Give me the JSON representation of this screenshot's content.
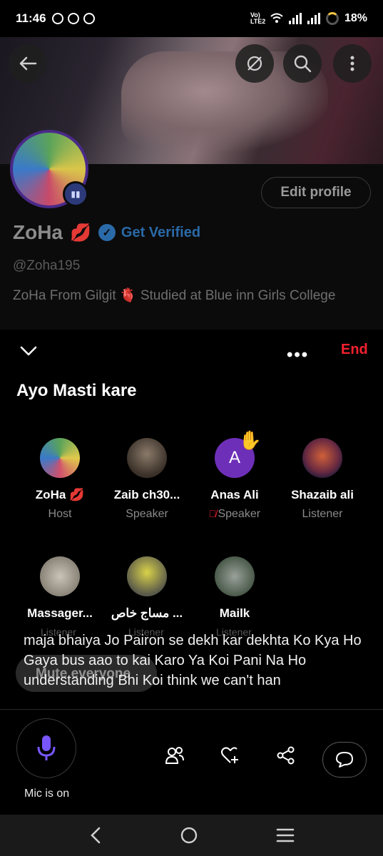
{
  "status_bar": {
    "time": "11:46",
    "network_label": "Vo) LTE2",
    "battery": "18%"
  },
  "profile": {
    "name": "ZoHa",
    "name_emoji": "💋",
    "verified_label": "Get Verified",
    "handle": "@Zoha195",
    "bio": "ZoHa From Gilgit 🫀  Studied at Blue inn Girls College",
    "edit_button": "Edit profile"
  },
  "space": {
    "end_label": "End",
    "title": "Ayo Masti kare",
    "participants": [
      {
        "name": "ZoHa 💋",
        "role": "Host"
      },
      {
        "name": "Zaib ch30...",
        "role": "Speaker"
      },
      {
        "name": "Anas Ali",
        "role": "Speaker",
        "initial": "A"
      },
      {
        "name": "Shazaib ali",
        "role": "Listener"
      },
      {
        "name": "Massager...",
        "role": "Listener"
      },
      {
        "name": "مساج خاص ...",
        "role": "Listener"
      },
      {
        "name": "Mailk",
        "role": "Listener"
      }
    ],
    "caption": "maja bhaiya Jo Pairon se dekh kar dekhta Ko Kya Ho Gaya bus aao to kai Karo Ya Koi Pani Na Ho understanding Bhi Koi think we can't han",
    "mute_everyone": "Mute everyone",
    "mic_label": "Mic is on"
  },
  "colors": {
    "end_red": "#f4212e",
    "mic_purple": "#7856ff",
    "verified_blue": "#1d9bf0"
  }
}
